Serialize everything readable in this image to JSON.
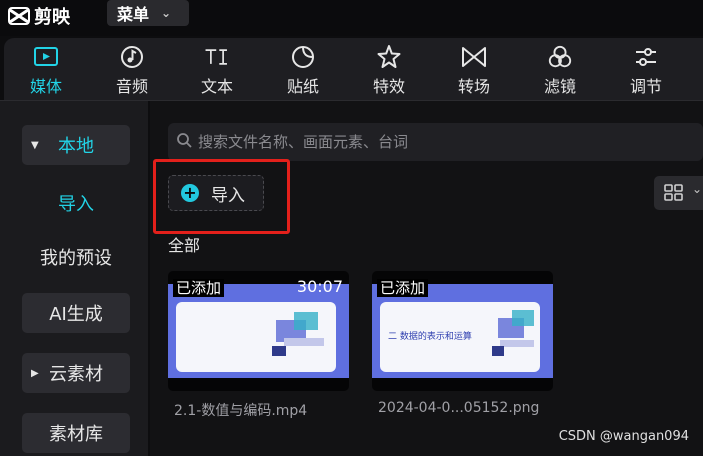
{
  "app": {
    "name": "剪映",
    "menu_label": "菜单"
  },
  "toolbar": {
    "items": [
      {
        "label": "媒体",
        "icon": "media-play-icon",
        "active": true
      },
      {
        "label": "音频",
        "icon": "music-note-icon"
      },
      {
        "label": "文本",
        "icon": "text-ti-icon"
      },
      {
        "label": "贴纸",
        "icon": "sticker-icon"
      },
      {
        "label": "特效",
        "icon": "sparkle-star-icon"
      },
      {
        "label": "转场",
        "icon": "transition-bowtie-icon"
      },
      {
        "label": "滤镜",
        "icon": "filter-circles-icon"
      },
      {
        "label": "调节",
        "icon": "sliders-icon"
      }
    ],
    "active_color": "#22d3e6"
  },
  "sidebar": {
    "items": [
      {
        "label": "本地",
        "expanded": true
      },
      {
        "label": "导入",
        "selected": true
      },
      {
        "label": "我的预设"
      },
      {
        "label": "AI生成"
      },
      {
        "label": "云素材"
      },
      {
        "label": "素材库"
      }
    ]
  },
  "search": {
    "placeholder": "搜索文件名称、画面元素、台词",
    "value": ""
  },
  "import_button": {
    "label": "导入"
  },
  "section_label": "全部",
  "media": [
    {
      "badge": "已添加",
      "duration": "30:07",
      "filename": "2.1-数值与编码.mp4",
      "slide_text": ""
    },
    {
      "badge": "已添加",
      "duration": "",
      "filename": "2024-04-0...05152.png",
      "slide_text": "二 数据的表示和运算"
    }
  ],
  "watermark": "CSDN @wangan094",
  "colors": {
    "accent": "#22d3e6",
    "highlight_box": "#e3201b"
  }
}
